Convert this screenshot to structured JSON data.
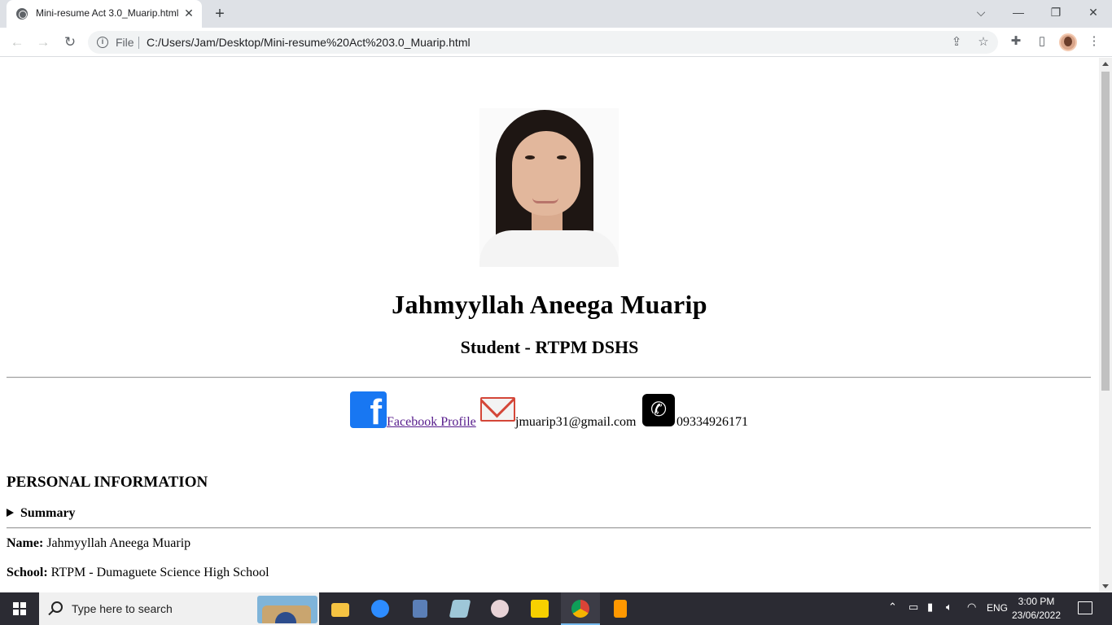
{
  "browser": {
    "tab_title": "Mini-resume Act 3.0_Muarip.html",
    "tab_close": "✕",
    "new_tab": "+",
    "file_label": "File",
    "url": "C:/Users/Jam/Desktop/Mini-resume%20Act%203.0_Muarip.html",
    "window_buttons": {
      "tab_search": "⌵",
      "minimize": "—",
      "restore": "❐",
      "close": "✕"
    }
  },
  "resume": {
    "name": "Jahmyyllah Aneega Muarip",
    "subtitle": "Student - RTPM DSHS",
    "contacts": {
      "facebook_label": "Facebook Profile",
      "email": "jmuarip31@gmail.com",
      "phone": "09334926171"
    },
    "section_title": "PERSONAL INFORMATION",
    "summary_label": "Summary",
    "fields": [
      {
        "label": "Name:",
        "value": "Jahmyyllah Aneega Muarip"
      },
      {
        "label": "School:",
        "value": "RTPM - Dumaguete Science High School"
      }
    ]
  },
  "taskbar": {
    "search_placeholder": "Type here to search",
    "language": "ENG",
    "time": "3:00 PM",
    "date": "23/06/2022"
  },
  "colors": {
    "facebook": "#1877f2",
    "link_visited": "#551a8b",
    "taskbar": "#2b2b33",
    "chrome_tabstrip": "#dee1e6"
  }
}
